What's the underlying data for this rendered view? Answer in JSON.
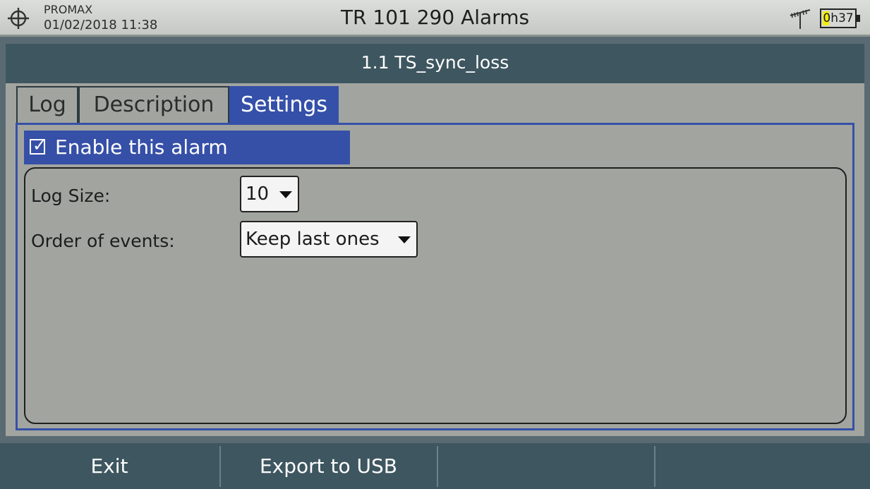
{
  "status": {
    "brand": "PROMAX",
    "datetime": "01/02/2018 11:38",
    "battery_text": "0h37",
    "battery_level": 0.2,
    "colors": {
      "battery_fill": "#f2ee00",
      "accent": "#3550a8"
    }
  },
  "window": {
    "title": "TR 101 290 Alarms"
  },
  "header": {
    "alarm_name": "1.1 TS_sync_loss"
  },
  "tabs": [
    {
      "label": "Log",
      "active": false
    },
    {
      "label": "Description",
      "active": false
    },
    {
      "label": "Settings",
      "active": true
    }
  ],
  "settings": {
    "enable_label": "Enable this alarm",
    "enabled": true,
    "log_size_label": "Log Size:",
    "log_size_value": "10",
    "order_label": "Order of events:",
    "order_value": "Keep last ones"
  },
  "softkeys": [
    "Exit",
    "Export to USB",
    "",
    ""
  ],
  "icons": {
    "top_left": "target-icon",
    "signal": "antenna-icon",
    "battery": "battery-icon"
  }
}
